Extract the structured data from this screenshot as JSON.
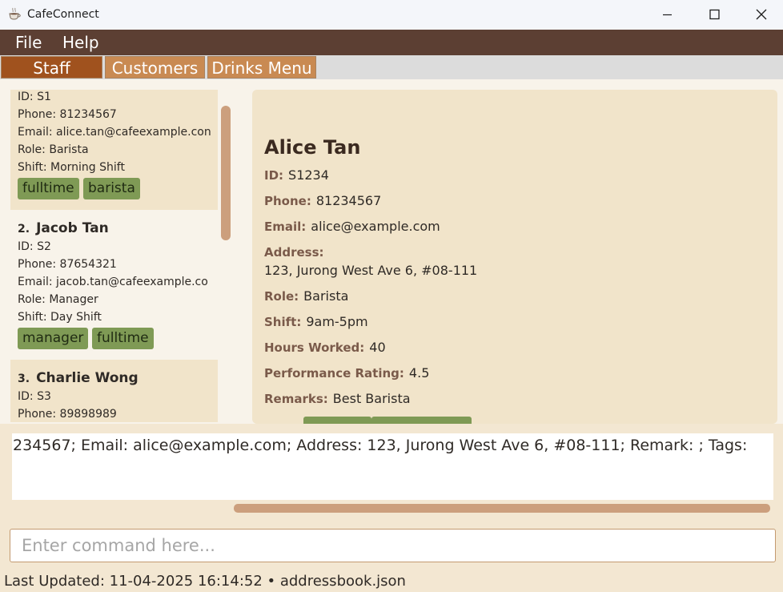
{
  "window": {
    "title": "CafeConnect",
    "icon": "coffee-cup-icon",
    "controls": [
      "minimize-icon",
      "maximize-icon",
      "close-icon"
    ]
  },
  "menu": {
    "file": "File",
    "help": "Help"
  },
  "tabs": [
    {
      "label": "Staff",
      "active": true
    },
    {
      "label": "Customers",
      "active": false
    },
    {
      "label": "Drinks Menu",
      "active": false
    }
  ],
  "staff_list": [
    {
      "index": "",
      "name": "",
      "id": "ID: S1",
      "phone": "Phone: 81234567",
      "email": "Email: alice.tan@cafeexample.con",
      "role": "Role: Barista",
      "shift": "Shift: Morning Shift",
      "tags": [
        "fulltime",
        "barista"
      ]
    },
    {
      "index": "2.",
      "name": "Jacob Tan",
      "id": "ID: S2",
      "phone": "Phone: 87654321",
      "email": "Email: jacob.tan@cafeexample.co",
      "role": "Role: Manager",
      "shift": "Shift: Day Shift",
      "tags": [
        "manager",
        "fulltime"
      ]
    },
    {
      "index": "3.",
      "name": "Charlie Wong",
      "id": "ID: S3",
      "phone": "Phone: 89898989"
    }
  ],
  "detail": {
    "name": "Alice Tan",
    "fields": {
      "id": {
        "label": "ID:",
        "value": "S1234"
      },
      "phone": {
        "label": "Phone:",
        "value": "81234567"
      },
      "email": {
        "label": "Email:",
        "value": "alice@example.com"
      },
      "address": {
        "label": "Address:",
        "value": "123, Jurong West Ave 6, #08-111"
      },
      "role": {
        "label": "Role:",
        "value": "Barista"
      },
      "shift": {
        "label": "Shift:",
        "value": "9am-5pm"
      },
      "hours": {
        "label": "Hours Worked:",
        "value": "40"
      },
      "rating": {
        "label": "Performance Rating:",
        "value": "4.5"
      },
      "remarks": {
        "label": "Remarks:",
        "value": "Best Barista"
      }
    }
  },
  "result_display": {
    "text": "234567; Email: alice@example.com; Address: 123, Jurong West Ave 6, #08-111; Remark: ; Tags:"
  },
  "command_box": {
    "placeholder": "Enter command here..."
  },
  "status_bar": {
    "text": "Last Updated: 11-04-2025 16:14:52 • addressbook.json"
  },
  "colors": {
    "menubar": "#5c3f33",
    "tab_active": "#a0521e",
    "tab_inactive": "#c98a52",
    "tag": "#7f9a55",
    "panel": "#f1e4ca",
    "scrollbar": "#cc9f7d"
  }
}
